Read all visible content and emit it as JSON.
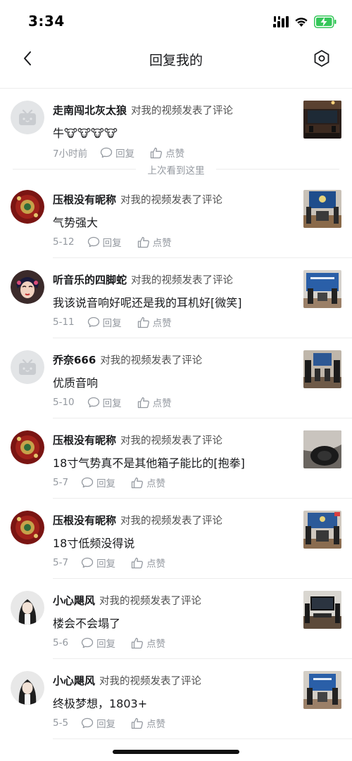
{
  "status_bar": {
    "time": "3:34"
  },
  "nav": {
    "title": "回复我的"
  },
  "divider": {
    "last_seen": "上次看到这里"
  },
  "labels": {
    "reply": "回复",
    "like": "点赞",
    "action": "对我的视频发表了评论"
  },
  "colors": {
    "text_primary": "#18191c",
    "text_secondary": "#9499a0",
    "divider": "#ececec",
    "battery_green": "#35c759"
  },
  "comments": [
    {
      "username": "走南闯北灰太狼",
      "comment": "牛🐮🐮🐮🐮",
      "time": "7小时前",
      "avatar": "default-tv-avatar",
      "thumb": "dark-speaker-room"
    },
    {
      "username": "压根没有昵称",
      "comment": "气势强大",
      "time": "5-12",
      "avatar": "red-ornament-avatar",
      "thumb": "blue-banner-room"
    },
    {
      "username": "听音乐的四脚蛇",
      "comment": "我该说音响好呢还是我的耳机好[微笑]",
      "time": "5-11",
      "avatar": "opera-portrait-avatar",
      "thumb": "blue-stage-room"
    },
    {
      "username": "乔奈666",
      "comment": "优质音响",
      "time": "5-10",
      "avatar": "default-tv-avatar",
      "thumb": "speaker-showroom"
    },
    {
      "username": "压根没有昵称",
      "comment": "18寸气势真不是其他箱子能比的[抱拳]",
      "time": "5-7",
      "avatar": "red-ornament-avatar",
      "thumb": "closeup-speaker"
    },
    {
      "username": "压根没有昵称",
      "comment": "18寸低频没得说",
      "time": "5-7",
      "avatar": "red-ornament-avatar",
      "thumb": "blue-banner-room-2"
    },
    {
      "username": "小心飓风",
      "comment": "楼会不会塌了",
      "time": "5-6",
      "avatar": "girl-portrait-avatar",
      "thumb": "tv-cabinet-room"
    },
    {
      "username": "小心飓风",
      "comment": "终极梦想，1803+",
      "time": "5-5",
      "avatar": "girl-portrait-avatar",
      "thumb": "blue-stage-room-2"
    }
  ]
}
